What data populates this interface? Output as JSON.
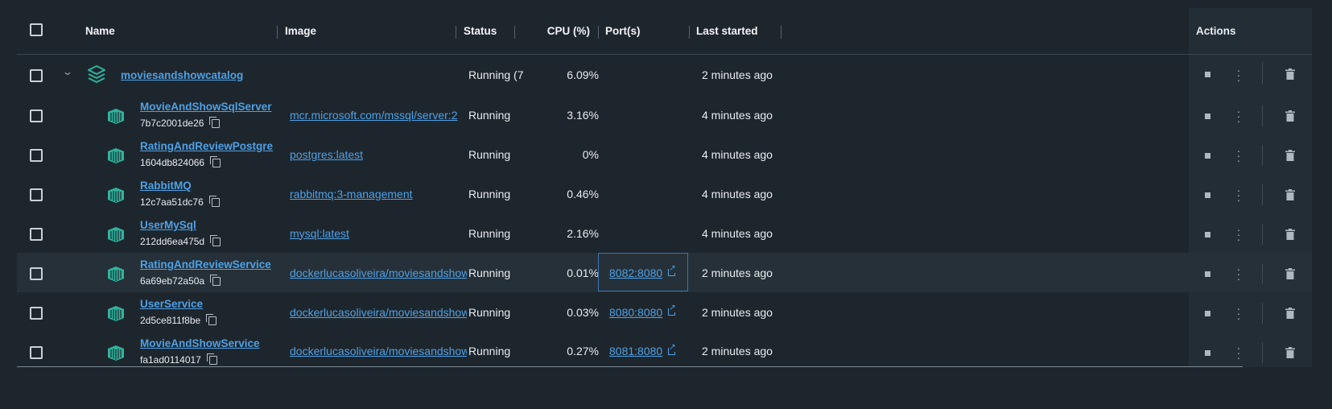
{
  "header": {
    "name": "Name",
    "image": "Image",
    "status": "Status",
    "cpu": "CPU (%)",
    "ports": "Port(s)",
    "last_started": "Last started",
    "actions": "Actions"
  },
  "group": {
    "name": "moviesandshowcatalog",
    "status": "Running (7",
    "cpu": "6.09%",
    "last_started": "2 minutes ago"
  },
  "containers": [
    {
      "name": "MovieAndShowSqlServer",
      "id": "7b7c2001de26",
      "image": "mcr.microsoft.com/mssql/server:2",
      "status": "Running",
      "cpu": "3.16%",
      "ports": "",
      "last_started": "4 minutes ago"
    },
    {
      "name": "RatingAndReviewPostgre",
      "id": "1604db824066",
      "image": "postgres:latest",
      "status": "Running",
      "cpu": "0%",
      "ports": "",
      "last_started": "4 minutes ago"
    },
    {
      "name": "RabbitMQ",
      "id": "12c7aa51dc76",
      "image": "rabbitmq:3-management",
      "status": "Running",
      "cpu": "0.46%",
      "ports": "",
      "last_started": "4 minutes ago"
    },
    {
      "name": "UserMySql",
      "id": "212dd6ea475d",
      "image": "mysql:latest",
      "status": "Running",
      "cpu": "2.16%",
      "ports": "",
      "last_started": "4 minutes ago"
    },
    {
      "name": "RatingAndReviewService",
      "id": "6a69eb72a50a",
      "image": "dockerlucasoliveira/moviesandshow",
      "status": "Running",
      "cpu": "0.01%",
      "ports": "8082:8080",
      "last_started": "2 minutes ago"
    },
    {
      "name": "UserService",
      "id": "2d5ce811f8be",
      "image": "dockerlucasoliveira/moviesandshow",
      "status": "Running",
      "cpu": "0.03%",
      "ports": "8080:8080",
      "last_started": "2 minutes ago"
    },
    {
      "name": "MovieAndShowService",
      "id": "fa1ad0114017",
      "image": "dockerlucasoliveira/moviesandshow",
      "status": "Running",
      "cpu": "0.27%",
      "ports": "8081:8080",
      "last_started": "2 minutes ago"
    }
  ],
  "icons": {
    "group": "stack-icon",
    "container": "container-icon",
    "copy": "copy-icon",
    "external": "external-link-icon",
    "stop": "stop-icon",
    "more": "more-vertical-icon",
    "delete": "trash-icon"
  },
  "colors": {
    "accent": "#4ea1e6",
    "container_icon": "#2fb39c",
    "background": "#1e262d"
  }
}
